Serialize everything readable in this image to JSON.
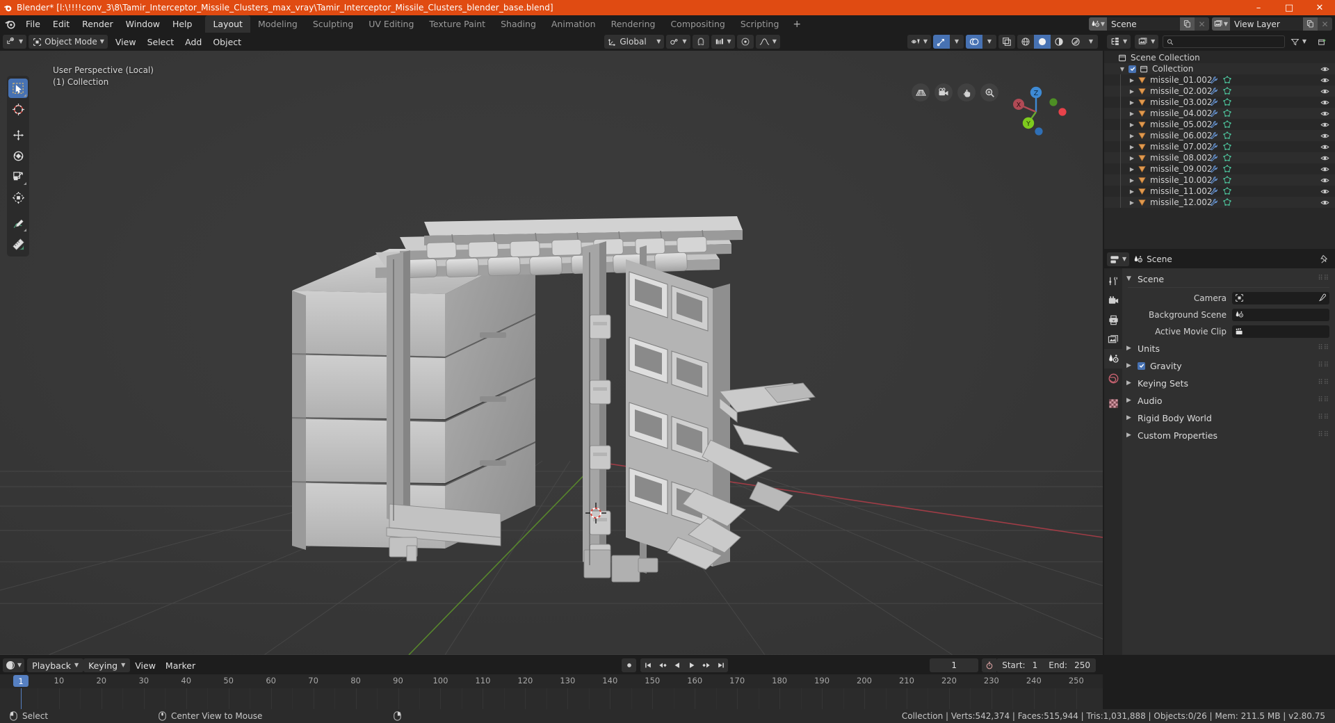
{
  "window": {
    "title": "Blender* [l:\\!!!!conv_3\\8\\Tamir_Interceptor_Missile_Clusters_max_vray\\Tamir_Interceptor_Missile_Clusters_blender_base.blend]",
    "minimize": "–",
    "maximize": "□",
    "close": "✕"
  },
  "topbar": {
    "menus": [
      "File",
      "Edit",
      "Render",
      "Window",
      "Help"
    ],
    "workspaces": [
      {
        "label": "Layout",
        "active": true
      },
      {
        "label": "Modeling",
        "active": false
      },
      {
        "label": "Sculpting",
        "active": false
      },
      {
        "label": "UV Editing",
        "active": false
      },
      {
        "label": "Texture Paint",
        "active": false
      },
      {
        "label": "Shading",
        "active": false
      },
      {
        "label": "Animation",
        "active": false
      },
      {
        "label": "Rendering",
        "active": false
      },
      {
        "label": "Compositing",
        "active": false
      },
      {
        "label": "Scripting",
        "active": false
      }
    ],
    "add_workspace": "+",
    "scene_name": "Scene",
    "view_layer_name": "View Layer"
  },
  "viewport": {
    "mode": "Object Mode",
    "menus": [
      "View",
      "Select",
      "Add",
      "Object"
    ],
    "transform_orientation": "Global",
    "overlay_line1": "User Perspective (Local)",
    "overlay_line2": "(1) Collection",
    "gizmo_axes": [
      "X",
      "Y",
      "Z"
    ],
    "nav_icons": [
      "grid-view-icon",
      "camera-view-icon",
      "pan-view-icon",
      "zoom-view-icon"
    ],
    "tools": [
      {
        "name": "tweak-select-tool",
        "active": true
      },
      {
        "name": "cursor-tool",
        "active": false
      },
      {
        "name": "move-tool",
        "active": false
      },
      {
        "name": "rotate-tool",
        "active": false
      },
      {
        "name": "scale-tool",
        "active": false
      },
      {
        "name": "transform-tool",
        "active": false
      },
      {
        "name": "annotate-tool",
        "active": false
      },
      {
        "name": "measure-tool",
        "active": false
      }
    ]
  },
  "outliner": {
    "display_mode": "View Layer",
    "search_placeholder": "",
    "rows": [
      {
        "label": "Scene Collection",
        "icon": "collection-icon",
        "depth": 0,
        "type": "scene",
        "checkbox": false,
        "disclosure": false,
        "eye": false,
        "modifier": false
      },
      {
        "label": "Collection",
        "icon": "collection-icon",
        "depth": 1,
        "type": "collection",
        "checkbox": true,
        "disclosure": true,
        "eye": true,
        "modifier": false
      },
      {
        "label": "missile_01.002",
        "icon": "object-mesh-icon",
        "depth": 2,
        "type": "object",
        "checkbox": false,
        "disclosure": true,
        "eye": true,
        "modifier": true
      },
      {
        "label": "missile_02.002",
        "icon": "object-mesh-icon",
        "depth": 2,
        "type": "object",
        "checkbox": false,
        "disclosure": true,
        "eye": true,
        "modifier": true
      },
      {
        "label": "missile_03.002",
        "icon": "object-mesh-icon",
        "depth": 2,
        "type": "object",
        "checkbox": false,
        "disclosure": true,
        "eye": true,
        "modifier": true
      },
      {
        "label": "missile_04.002",
        "icon": "object-mesh-icon",
        "depth": 2,
        "type": "object",
        "checkbox": false,
        "disclosure": true,
        "eye": true,
        "modifier": true
      },
      {
        "label": "missile_05.002",
        "icon": "object-mesh-icon",
        "depth": 2,
        "type": "object",
        "checkbox": false,
        "disclosure": true,
        "eye": true,
        "modifier": true
      },
      {
        "label": "missile_06.002",
        "icon": "object-mesh-icon",
        "depth": 2,
        "type": "object",
        "checkbox": false,
        "disclosure": true,
        "eye": true,
        "modifier": true
      },
      {
        "label": "missile_07.002",
        "icon": "object-mesh-icon",
        "depth": 2,
        "type": "object",
        "checkbox": false,
        "disclosure": true,
        "eye": true,
        "modifier": true
      },
      {
        "label": "missile_08.002",
        "icon": "object-mesh-icon",
        "depth": 2,
        "type": "object",
        "checkbox": false,
        "disclosure": true,
        "eye": true,
        "modifier": true
      },
      {
        "label": "missile_09.002",
        "icon": "object-mesh-icon",
        "depth": 2,
        "type": "object",
        "checkbox": false,
        "disclosure": true,
        "eye": true,
        "modifier": true
      },
      {
        "label": "missile_10.002",
        "icon": "object-mesh-icon",
        "depth": 2,
        "type": "object",
        "checkbox": false,
        "disclosure": true,
        "eye": true,
        "modifier": true
      },
      {
        "label": "missile_11.002",
        "icon": "object-mesh-icon",
        "depth": 2,
        "type": "object",
        "checkbox": false,
        "disclosure": true,
        "eye": true,
        "modifier": true
      },
      {
        "label": "missile_12.002",
        "icon": "object-mesh-icon",
        "depth": 2,
        "type": "object",
        "checkbox": false,
        "disclosure": true,
        "eye": true,
        "modifier": true
      }
    ]
  },
  "properties": {
    "breadcrumb_icon": "scene-icon",
    "breadcrumb": "Scene",
    "pin_icon": "pin-icon",
    "tabs": [
      {
        "name": "tool-tab",
        "active": false
      },
      {
        "name": "render-tab",
        "active": false
      },
      {
        "name": "output-tab",
        "active": false
      },
      {
        "name": "view-layer-tab",
        "active": false
      },
      {
        "name": "scene-tab",
        "active": true
      },
      {
        "name": "world-tab",
        "active": false
      },
      {
        "name": "texture-tab",
        "active": false
      }
    ],
    "panels": [
      {
        "title": "Scene",
        "open": true
      },
      {
        "title": "Units",
        "open": false
      },
      {
        "title": "Gravity",
        "open": false,
        "checkbox": true
      },
      {
        "title": "Keying Sets",
        "open": false
      },
      {
        "title": "Audio",
        "open": false
      },
      {
        "title": "Rigid Body World",
        "open": false
      },
      {
        "title": "Custom Properties",
        "open": false
      }
    ],
    "scene_fields": [
      {
        "label": "Camera",
        "value": "",
        "icon": "camera-data-icon",
        "eyedropper": true
      },
      {
        "label": "Background Scene",
        "value": "",
        "icon": "scene-icon",
        "eyedropper": false
      },
      {
        "label": "Active Movie Clip",
        "value": "",
        "icon": "movie-clip-icon",
        "eyedropper": false
      }
    ]
  },
  "timeline": {
    "menus": [
      "Playback",
      "Keying",
      "View",
      "Marker"
    ],
    "current_frame": "1",
    "start_label": "Start:",
    "start_value": "1",
    "end_label": "End:",
    "end_value": "250",
    "ticks": [
      "1",
      "10",
      "20",
      "30",
      "40",
      "50",
      "60",
      "70",
      "80",
      "90",
      "100",
      "110",
      "120",
      "130",
      "140",
      "150",
      "160",
      "170",
      "180",
      "190",
      "200",
      "210",
      "220",
      "230",
      "240",
      "250"
    ],
    "playhead_frame": "1",
    "record_icon": "record-icon",
    "transport_icons": [
      "jump-start-icon",
      "prev-keyframe-icon",
      "play-reverse-icon",
      "play-icon",
      "next-keyframe-icon",
      "jump-end-icon"
    ],
    "timer_icon": "stopwatch-icon"
  },
  "statusbar": {
    "left_items": [
      {
        "icon": "mouse-left-icon",
        "label": "Select"
      },
      {
        "icon": "mouse-middle-icon",
        "label": "Center View to Mouse"
      },
      {
        "icon": "mouse-right-icon",
        "label": ""
      }
    ],
    "stats": "Collection | Verts:542,374 | Faces:515,944 | Tris:1,031,888 | Objects:0/26 | Mem: 211.5 MB | v2.80.75"
  },
  "colors": {
    "accent_orange": "#e04b12",
    "accent_blue": "#4772b3",
    "viewport_bg": "#3c3c3c",
    "panel_bg": "#303030",
    "header_bg": "#1d1d1d",
    "outliner_bg": "#282828",
    "mesh_orange": "#ed9e5c",
    "mesh_green": "#4ec9a0",
    "modifier_blue": "#6a9ce0"
  }
}
